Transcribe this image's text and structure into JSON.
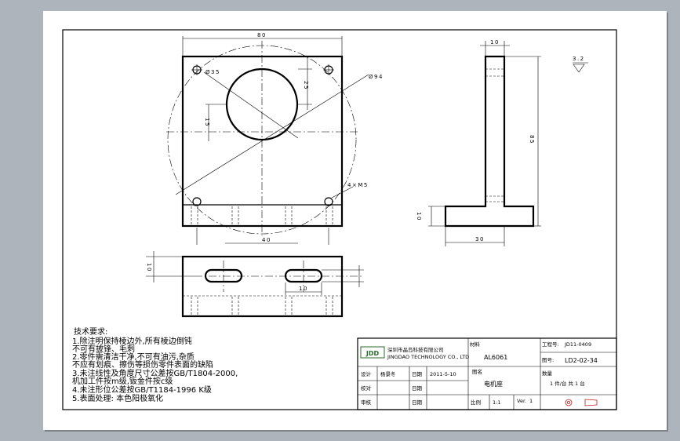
{
  "notes": {
    "title": "技术要求:",
    "lines": [
      "1.除注明保持棱边外,所有棱边倒钝",
      "   不可有披锋、毛刺",
      "2.零件需清洁干净,不可有油污,杂质",
      "   不应有划痕、擦伤等损伤零件表面的缺陷",
      "3.未注线性及角度尺寸公差按GB/T1804-2000,",
      "   机加工件按m级,钣金件按c级",
      "4.未注形位公差按GB/T1184-1996 K级",
      "5.表面处理: 本色阳极氧化"
    ]
  },
  "dimensions": {
    "top_width": "80",
    "hole_dia": "Ø35",
    "bolt_circle": "Ø94",
    "dim_25": "25",
    "dim_15": "15",
    "tapped_holes": "4×M5",
    "hole_spacing": "40",
    "thickness_left": "10",
    "slot_len": "10",
    "side_top": "10",
    "side_height": "85",
    "side_bottom_h": "10",
    "side_width": "30"
  },
  "surface_finish": "3.2",
  "title_block": {
    "company_cn": "深圳市晶岛科技有限公司",
    "company_en": "JINGDAO TECHNOLOGY CO., LTD",
    "logo": "JDD",
    "material_label": "材料",
    "material": "AL6061",
    "project_label": "工程号:",
    "project": "JD11-0409",
    "drawing_no_label": "图号:",
    "drawing_no": "LD2-02-34",
    "quantity_label": "数量",
    "quantity": "1 件/台   共 1 台",
    "design_label": "设计",
    "designer": "杨景冬",
    "date_label": "日期",
    "date": "2011-5-10",
    "name_label": "图名",
    "part_name": "电机座",
    "check_label": "校对",
    "date_label2": "日期",
    "approve_label": "审核",
    "date_label3": "日期",
    "scale_label": "比例",
    "scale": "1:1",
    "version_label": "Ver.",
    "version": "1"
  }
}
